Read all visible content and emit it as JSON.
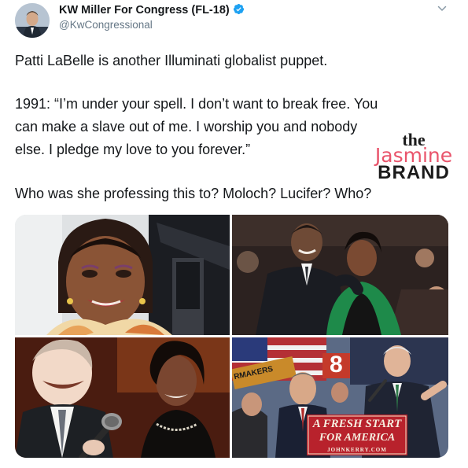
{
  "author": {
    "display_name": "KW Miller For Congress (FL-18)",
    "handle": "@KwCongressional"
  },
  "icons": [
    "verified-badge-icon",
    "chevron-down-icon"
  ],
  "tweet": {
    "line1": "Patti LaBelle is another Illuminati globalist puppet.",
    "quote_l1": "1991: “I’m under your spell. I don’t want to break free. You",
    "quote_l2": "can make a slave out of me. I worship you and nobody",
    "quote_l3": "else. I pledge my love to you forever.”",
    "question": "Who was she professing this to? Moloch? Lucifer? Who?"
  },
  "watermark": {
    "the": "the",
    "jasmine": "Jasmine",
    "brand": "BRAND"
  },
  "photos": {
    "photo4_sign_makers": "RMAKERS",
    "photo4_number": "8",
    "photo4_banner_l1": "A FRESH START",
    "photo4_banner_l2": "FOR AMERICA",
    "photo4_banner_url": "JOHNKERRY.COM"
  },
  "colors": {
    "verified_blue": "#1da1f2",
    "handle_gray": "#657786",
    "jasmine_pink": "#e9546b"
  }
}
